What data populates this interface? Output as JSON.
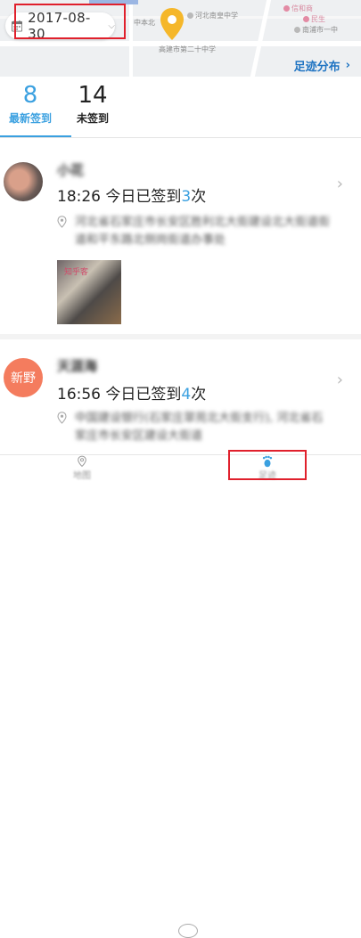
{
  "map": {
    "poi_school": "河北南皇中学",
    "poi_bank": "信和商",
    "poi_bank2": "民生",
    "poi_left": "长沙中山",
    "poi_mid": "中本北",
    "poi_bottom": "高建市第二十中学",
    "poi_right": "南浦市一中"
  },
  "date_picker": {
    "value": "2017-08-30"
  },
  "footprint_link": {
    "label": "足迹分布",
    "arrow": "›"
  },
  "stats": {
    "signed": {
      "count": "8",
      "label": "最新签到"
    },
    "unsigned": {
      "count": "14",
      "label": "未签到"
    }
  },
  "records": [
    {
      "name": "小花",
      "time_prefix": "18:26 今日已签到",
      "count": "3",
      "suffix": "次",
      "address": "河北省石家庄市长安区胜利北大街建设北大街道街道和平东路北侧岗街道办事处",
      "photo_tag": "知乎客"
    },
    {
      "name": "天涯海",
      "avatar_text": "新野",
      "time_prefix": "16:56 今日已签到",
      "count": "4",
      "suffix": "次",
      "address": "中国建设银行(石家庄翠苑北大街支行), 河北省石家庄市长安区建设大街道"
    }
  ],
  "tabbar": {
    "nav_label": "地图",
    "foot_label": "足迹"
  },
  "colors": {
    "accent": "#3aa0e0",
    "link": "#1e73c2",
    "highlight": "#e0202c"
  }
}
